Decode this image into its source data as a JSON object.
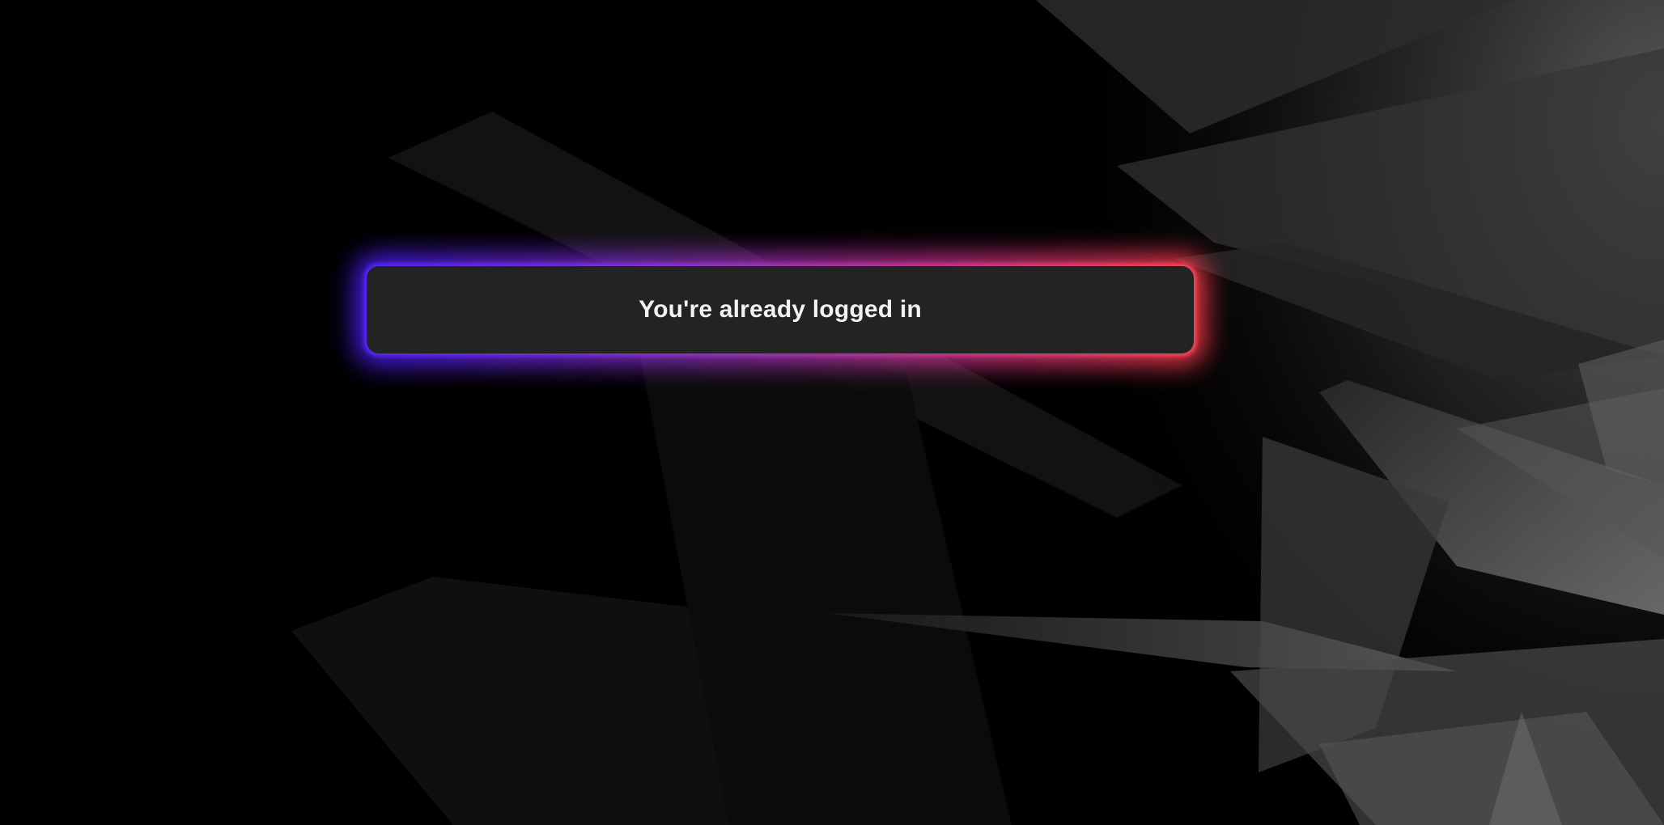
{
  "notice": {
    "message": "You're already logged in"
  },
  "theme": {
    "background": "#000000",
    "banner_background": "#232323",
    "banner_text_color": "#f2f2f2",
    "glow_gradient": [
      "#4a1cff",
      "#7a2bd0",
      "#c03094",
      "#ff3a4a"
    ]
  },
  "decor": {
    "background_art": "abstract-gray-shards"
  }
}
